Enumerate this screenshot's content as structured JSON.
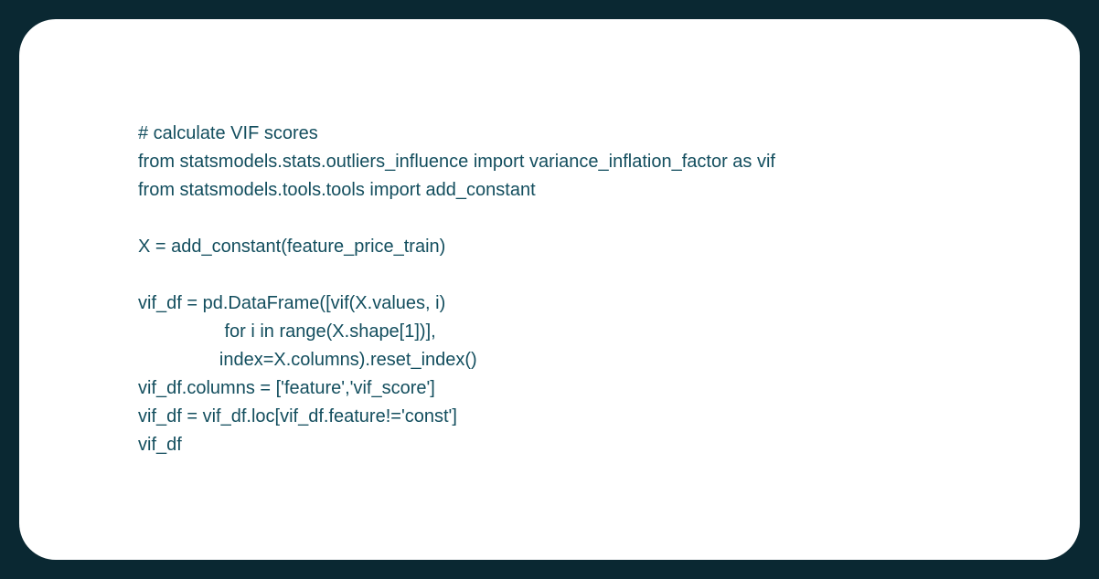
{
  "code": {
    "line1": "# calculate VIF scores",
    "line2": "from statsmodels.stats.outliers_influence import variance_inflation_factor as vif",
    "line3": "from statsmodels.tools.tools import add_constant",
    "line4": "",
    "line5": "X = add_constant(feature_price_train)",
    "line6": "",
    "line7": "vif_df = pd.DataFrame([vif(X.values, i)",
    "line8": "                 for i in range(X.shape[1])],",
    "line9": "                index=X.columns).reset_index()",
    "line10": "vif_df.columns = ['feature','vif_score']",
    "line11": "vif_df = vif_df.loc[vif_df.feature!='const']",
    "line12": "vif_df"
  }
}
